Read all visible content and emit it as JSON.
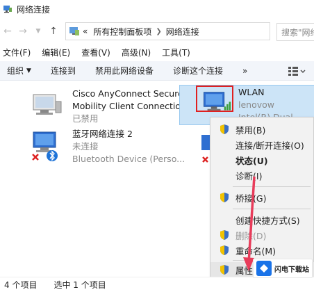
{
  "window": {
    "title": "网络连接"
  },
  "address": {
    "prefix": "«",
    "crumbs": [
      "所有控制面板项",
      "网络连接"
    ],
    "search_placeholder": "搜索\"网络"
  },
  "menu": [
    "文件(F)",
    "编辑(E)",
    "查看(V)",
    "高级(N)",
    "工具(T)"
  ],
  "toolbar": {
    "organize": "组织",
    "connect": "连接到",
    "disable": "禁用此网络设备",
    "diagnose": "诊断这个连接",
    "more": "»"
  },
  "adapters": {
    "cisco": {
      "name": "Cisco AnyConnect Secure",
      "name2": "Mobility Client Connection",
      "status": "已禁用"
    },
    "bluetooth": {
      "name": "蓝牙网络连接 2",
      "status": "未连接",
      "device": "Bluetooth Device (Perso..."
    },
    "wlan": {
      "name": "WLAN",
      "network": "lenovow",
      "device": "Intel(R) Dual Band..."
    }
  },
  "context_menu": {
    "disable": "禁用(B)",
    "connect": "连接/断开连接(O)",
    "status": "状态(U)",
    "diagnose": "诊断(I)",
    "bridge": "桥接(G)",
    "shortcut": "创建快捷方式(S)",
    "delete": "删除(D)",
    "rename": "重命名(M)",
    "properties": "属性(R)"
  },
  "status": {
    "count": "4 个项目",
    "selected": "选中 1 个项目"
  },
  "watermark": {
    "text": "闪电下载站"
  },
  "colors": {
    "selection": "#cce4f7",
    "highlight_box": "#e02020",
    "arrow": "#e83c5a",
    "toolbar": "#f2f5fa"
  }
}
